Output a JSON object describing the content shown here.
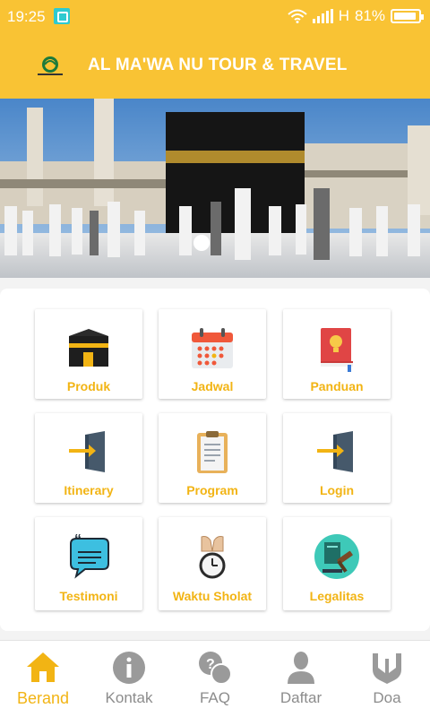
{
  "status_bar": {
    "time": "19:25",
    "network": "H",
    "battery": "81%",
    "battery_level": 0.81
  },
  "header": {
    "title": "AL MA'WA NU TOUR & TRAVEL",
    "logo_icon": "nu-logo-icon",
    "background": "#f9c334"
  },
  "banner": {
    "image": "kaaba-photo",
    "slide_indicator": "dot"
  },
  "menu": {
    "label_color": "#f2b414",
    "items": [
      {
        "label": "Produk",
        "icon": "kaaba-icon"
      },
      {
        "label": "Jadwal",
        "icon": "calendar-icon"
      },
      {
        "label": "Panduan",
        "icon": "guide-book-icon"
      },
      {
        "label": "Itinerary",
        "icon": "door-enter-icon"
      },
      {
        "label": "Program",
        "icon": "clipboard-icon"
      },
      {
        "label": "Login",
        "icon": "login-door-icon"
      },
      {
        "label": "Testimoni",
        "icon": "quote-bubble-icon"
      },
      {
        "label": "Waktu Sholat",
        "icon": "prayer-clock-icon"
      },
      {
        "label": "Legalitas",
        "icon": "legal-gavel-icon"
      }
    ]
  },
  "bottom_nav": {
    "active_color": "#f2b414",
    "items": [
      {
        "label": "Berand",
        "icon": "home-icon"
      },
      {
        "label": "Kontak",
        "icon": "info-icon"
      },
      {
        "label": "FAQ",
        "icon": "faq-icon"
      },
      {
        "label": "Daftar",
        "icon": "person-icon"
      },
      {
        "label": "Doa",
        "icon": "praying-hands-icon"
      }
    ]
  }
}
